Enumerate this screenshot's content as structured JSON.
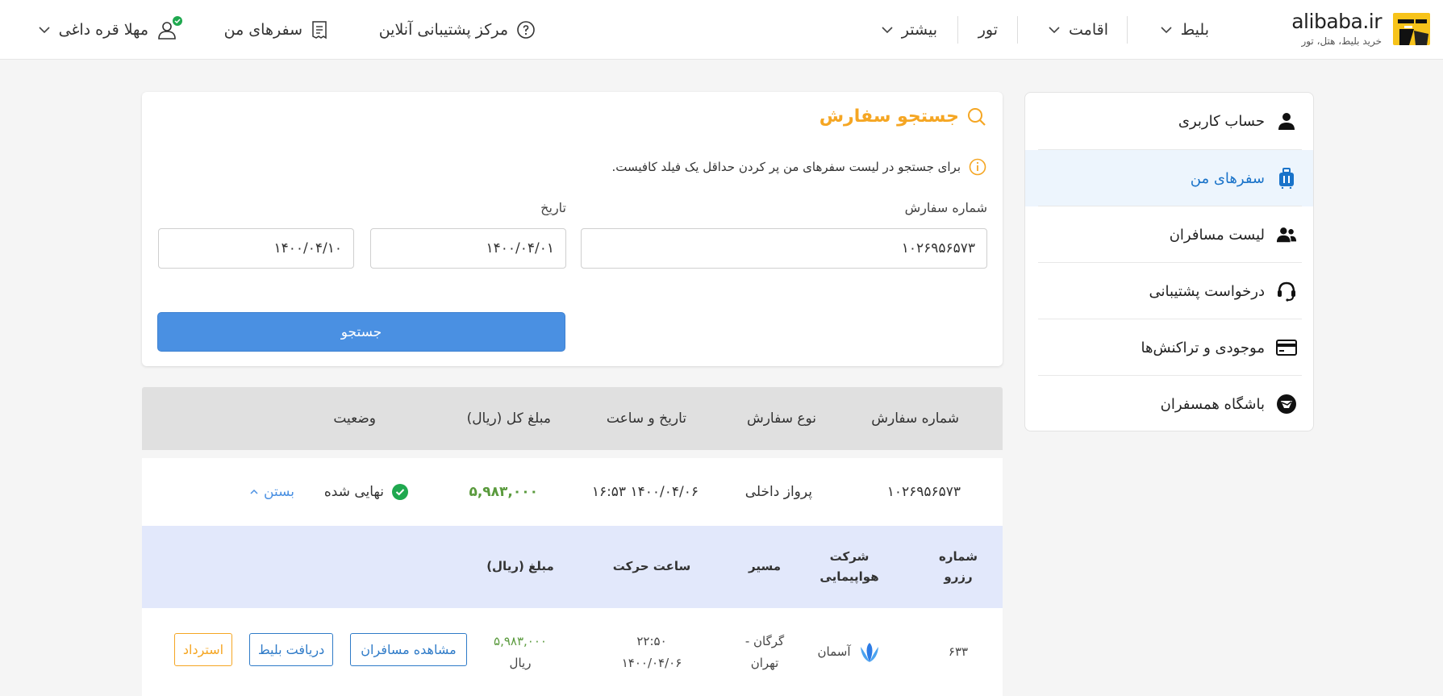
{
  "brand": {
    "name": "alibaba.ir",
    "tagline": "خرید بلیط، هتل، تور"
  },
  "nav": {
    "ticket": "بلیط",
    "stay": "اقامت",
    "tour": "تور",
    "more": "بیشتر",
    "support": "مرکز پشتیبانی آنلاین",
    "my_trips": "سفرهای من",
    "user": "مهلا قره داغی"
  },
  "sidebar": {
    "items": [
      {
        "label": "حساب کاربری",
        "icon": "user-icon"
      },
      {
        "label": "سفرهای من",
        "icon": "luggage-icon"
      },
      {
        "label": "لیست مسافران",
        "icon": "users-icon"
      },
      {
        "label": "درخواست پشتیبانی",
        "icon": "headset-icon"
      },
      {
        "label": "موجودی و تراکنش‌ها",
        "icon": "card-icon"
      },
      {
        "label": "باشگاه همسفران",
        "icon": "club-icon"
      }
    ],
    "active_index": 1
  },
  "search": {
    "title": "جستجو سفارش",
    "hint": "برای جستجو در لیست سفرهای من پر کردن حداقل یک فیلد کافیست.",
    "order_label": "شماره سفارش",
    "order_value": "۱۰۲۶۹۵۶۵۷۳",
    "date_label": "تاریخ",
    "date_from": "۱۴۰۰/۰۴/۰۱",
    "date_to": "۱۴۰۰/۰۴/۱۰",
    "button": "جستجو"
  },
  "orders": {
    "headers": {
      "order_no": "شماره سفارش",
      "type": "نوع سفارش",
      "datetime": "تاریخ و ساعت",
      "total": "مبلغ کل (ریال)",
      "status": "وضعیت"
    },
    "row": {
      "order_no": "۱۰۲۶۹۵۶۵۷۳",
      "type": "پرواز داخلی",
      "datetime": "۱۴۰۰/۰۴/۰۶ ۱۶:۵۳",
      "total": "۵,۹۸۳,۰۰۰",
      "status": "نهایی شده",
      "close": "بستن"
    }
  },
  "detail": {
    "headers": {
      "reserve_line1": "شماره",
      "reserve_line2": "رزرو",
      "airline_line1": "شرکت",
      "airline_line2": "هواپیمایی",
      "route": "مسیر",
      "departure": "ساعت حرکت",
      "price": "مبلغ (ریال)"
    },
    "row": {
      "reserve": "۶۳۳",
      "airline": "آسمان",
      "route_line1": "گرگان -",
      "route_line2": "تهران",
      "time": "۲۲:۵۰",
      "date": "۱۴۰۰/۰۴/۰۶",
      "price": "۵,۹۸۳,۰۰۰",
      "currency": "ریال"
    },
    "actions": {
      "passengers": "مشاهده مسافران",
      "ticket": "دریافت بلیط",
      "refund": "استرداد"
    }
  },
  "colors": {
    "accent_orange": "#f5a623",
    "primary_blue": "#4a90e2",
    "success_green": "#1fa84f",
    "amount_green": "#5a9a3d"
  }
}
